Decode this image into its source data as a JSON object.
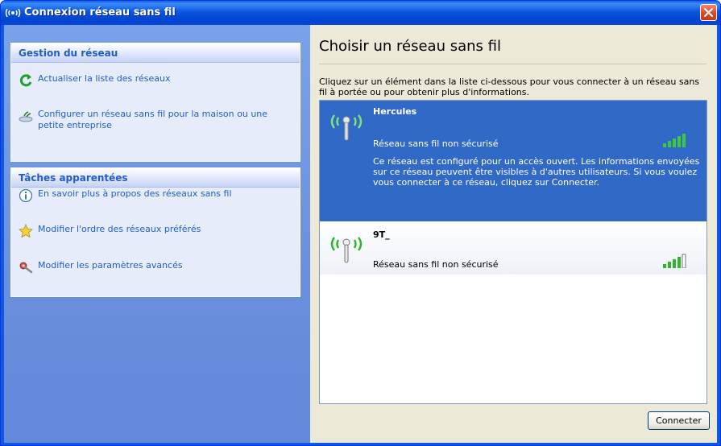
{
  "window": {
    "title": "Connexion réseau sans fil",
    "title_icon": "wireless-network-icon",
    "close_icon": "close-icon"
  },
  "sidebar": {
    "groups": [
      {
        "title": "Gestion du réseau",
        "items": [
          {
            "label": "Actualiser la liste des réseaux",
            "icon": "refresh-icon"
          },
          {
            "label": "Configurer un réseau sans fil pour la maison ou une petite entreprise",
            "icon": "setup-wizard-icon"
          }
        ]
      },
      {
        "title": "Tâches apparentées",
        "items": [
          {
            "label": "En savoir plus à propos des réseaux sans fil",
            "icon": "info-icon"
          },
          {
            "label": "Modifier l'ordre des réseaux préférés",
            "icon": "star-icon"
          },
          {
            "label": "Modifier les paramètres avancés",
            "icon": "tools-icon"
          }
        ]
      }
    ]
  },
  "main": {
    "title": "Choisir un réseau sans fil",
    "description": "Cliquez sur un élément dans la liste ci-dessous pour vous connecter à un réseau sans fil à portée ou pour obtenir plus d'informations.",
    "networks": [
      {
        "ssid": "Hercules",
        "security": "Réseau sans fil non sécurisé",
        "message": "Ce réseau est configuré pour un accès ouvert. Les informations envoyées sur ce réseau peuvent être visibles à d'autres utilisateurs. Si vous voulez vous connecter à ce réseau, cliquez sur Connecter.",
        "selected": true,
        "signal_bars": 5,
        "signal_max": 5
      },
      {
        "ssid": "9T_",
        "security": "Réseau sans fil non sécurisé",
        "selected": false,
        "signal_bars": 4,
        "signal_max": 5
      }
    ],
    "connect_label": "Connecter"
  },
  "colors": {
    "titlebar": "#0a56e0",
    "taskpane": "#6a8fdd",
    "link": "#215dc6",
    "selection": "#3169c6",
    "signal_green": "#2fb52f"
  }
}
